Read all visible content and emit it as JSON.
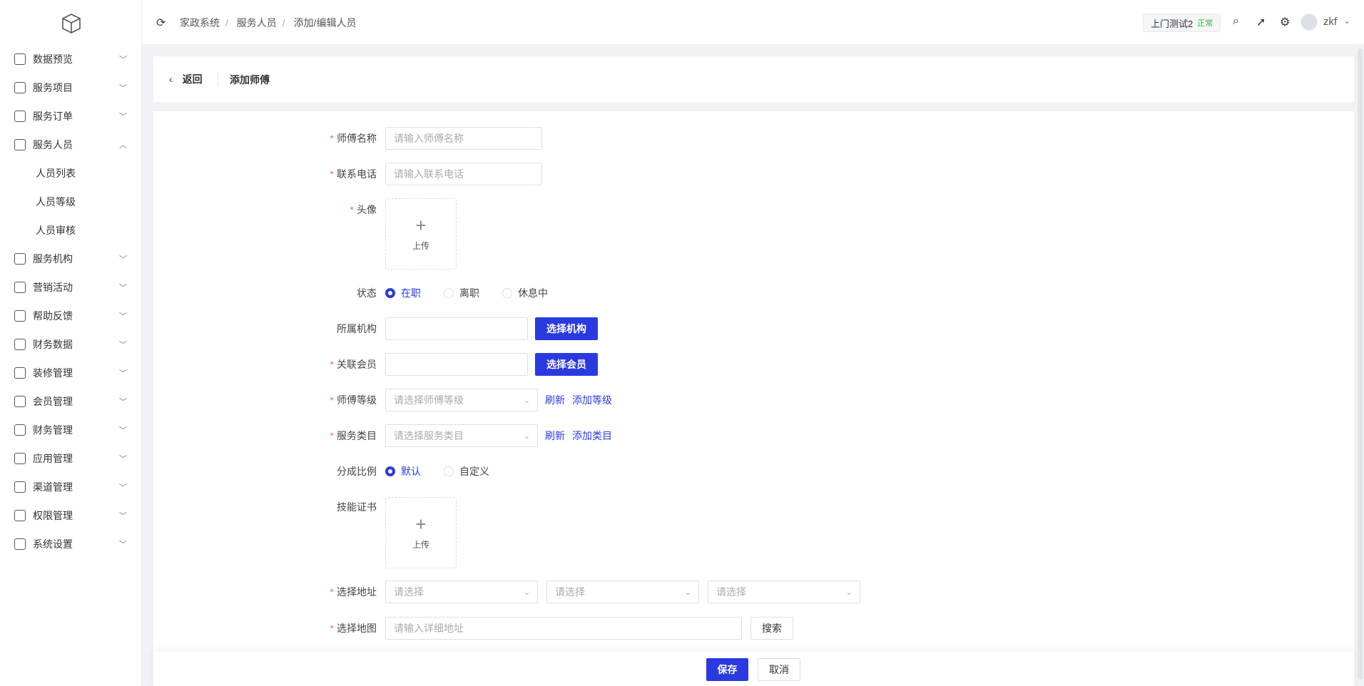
{
  "sidebar": {
    "items": [
      {
        "label": "数据预览",
        "icon": "chart-icon",
        "expanded": false
      },
      {
        "label": "服务项目",
        "icon": "wallet-icon",
        "expanded": false
      },
      {
        "label": "服务订单",
        "icon": "order-icon",
        "expanded": false
      },
      {
        "label": "服务人员",
        "icon": "user-icon",
        "expanded": true,
        "children": [
          "人员列表",
          "人员等级",
          "人员审核"
        ]
      },
      {
        "label": "服务机构",
        "icon": "user-icon",
        "expanded": false
      },
      {
        "label": "营销活动",
        "icon": "order-icon",
        "expanded": false
      },
      {
        "label": "帮助反馈",
        "icon": "feedback-icon",
        "expanded": false
      },
      {
        "label": "财务数据",
        "icon": "finance-icon",
        "expanded": false
      },
      {
        "label": "装修管理",
        "icon": "decorate-icon",
        "expanded": false
      },
      {
        "label": "会员管理",
        "icon": "diamond-icon",
        "expanded": false
      },
      {
        "label": "财务管理",
        "icon": "finance-icon",
        "expanded": false
      },
      {
        "label": "应用管理",
        "icon": "cube-icon",
        "expanded": false
      },
      {
        "label": "渠道管理",
        "icon": "channel-icon",
        "expanded": false
      },
      {
        "label": "权限管理",
        "icon": "lock-icon",
        "expanded": false
      },
      {
        "label": "系统设置",
        "icon": "gear-icon",
        "expanded": false
      }
    ]
  },
  "header": {
    "breadcrumb": [
      "家政系统",
      "服务人员",
      "添加/编辑人员"
    ],
    "tenant": "上门测试2",
    "tenant_status": "正常",
    "user": "zkf"
  },
  "page": {
    "back": "返回",
    "title": "添加师傅"
  },
  "form": {
    "name": {
      "label": "师傅名称",
      "placeholder": "请输入师傅名称"
    },
    "phone": {
      "label": "联系电话",
      "placeholder": "请输入联系电话"
    },
    "avatar": {
      "label": "头像",
      "upload": "上传"
    },
    "status": {
      "label": "状态",
      "options": [
        "在职",
        "离职",
        "休息中"
      ],
      "selected": "在职"
    },
    "org": {
      "label": "所属机构",
      "button": "选择机构"
    },
    "member": {
      "label": "关联会员",
      "button": "选择会员"
    },
    "level": {
      "label": "师傅等级",
      "placeholder": "请选择师傅等级",
      "refresh": "刷新",
      "add": "添加等级"
    },
    "category": {
      "label": "服务类目",
      "placeholder": "请选择服务类目",
      "refresh": "刷新",
      "add": "添加类目"
    },
    "ratio": {
      "label": "分成比例",
      "options": [
        "默认",
        "自定义"
      ],
      "selected": "默认"
    },
    "cert": {
      "label": "技能证书",
      "upload": "上传"
    },
    "address": {
      "label": "选择地址",
      "placeholders": [
        "请选择",
        "请选择",
        "请选择"
      ]
    },
    "map": {
      "label": "选择地图",
      "placeholder": "请输入详细地址",
      "search": "搜索"
    }
  },
  "footer": {
    "save": "保存",
    "cancel": "取消"
  },
  "colors": {
    "accent": "#2a3ae0",
    "required": "#f56c6c",
    "status_ok": "#3cb43c"
  }
}
